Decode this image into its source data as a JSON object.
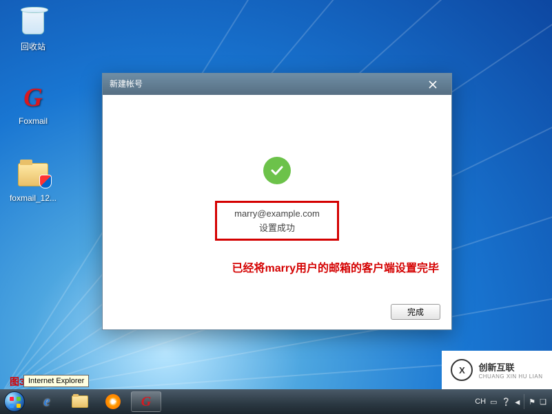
{
  "desktop": {
    "recycle_bin": "回收站",
    "foxmail": "Foxmail",
    "foxmail_pkg": "foxmail_12..."
  },
  "dialog": {
    "title": "新建帐号",
    "email": "marry@example.com",
    "status": "设置成功",
    "annotation": "已经将marry用户的邮箱的客户端设置完毕",
    "done": "完成"
  },
  "tooltip": "Internet Explorer",
  "fig_label": "图3-10",
  "tray": {
    "ime": "CH",
    "time": ""
  },
  "watermark": {
    "brand_cn": "创新互联",
    "brand_py": "CHUANG XIN HU LIAN"
  }
}
